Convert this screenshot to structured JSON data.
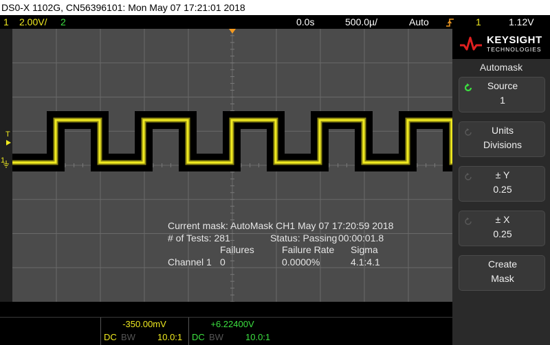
{
  "title": "DS0-X 1102G, CN56396101: Mon May 07 17:21:01 2018",
  "status": {
    "ch1_num": "1",
    "ch1_scale": "2.00V/",
    "ch2_num": "2",
    "time_delay": "0.0s",
    "time_scale": "500.0µ/",
    "trigger_mode": "Auto",
    "trigger_icon": "trigger-edge-icon",
    "trigger_source": "1",
    "trigger_level": "1.12V"
  },
  "markers": {
    "trigger_level": "T",
    "ch1_ground": "1"
  },
  "mask_info": {
    "line1": "Current mask: AutoMask CH1 May 07 17:20:59 2018",
    "tests_label": "# of Tests: 281",
    "status_label": "Status: Passing",
    "elapsed": "00:00:01.8",
    "col_failures": "Failures",
    "col_failure_rate": "Failure Rate",
    "col_sigma": "Sigma",
    "channel": "Channel 1",
    "failures": "0",
    "failure_rate": "0.0000%",
    "sigma": "4.1:4.1"
  },
  "sidebar": {
    "brand": "KEYSIGHT",
    "brand_sub": "TECHNOLOGIES",
    "menu_title": "Automask",
    "softkeys": [
      {
        "label": "Source",
        "value": "1",
        "icon": "rotate-knob-icon",
        "active": true
      },
      {
        "label": "Units",
        "value": "Divisions",
        "icon": "rotate-knob-icon",
        "active": false
      },
      {
        "label": "± Y",
        "value": "0.25",
        "icon": "rotate-knob-icon",
        "active": false
      },
      {
        "label": "± X",
        "value": "0.25",
        "icon": "rotate-knob-icon",
        "active": false
      },
      {
        "label": "Create",
        "value": "Mask",
        "icon": "",
        "active": false
      }
    ]
  },
  "channels": {
    "ch1": {
      "offset": "-350.00mV",
      "coupling": "DC",
      "bw": "BW",
      "probe": "10.0:1"
    },
    "ch2": {
      "offset": "+6.22400V",
      "coupling": "DC",
      "bw": "BW",
      "probe": "10.0:1"
    }
  },
  "colors": {
    "ch1": "#f0ea20",
    "ch2": "#3ce040",
    "grid_bg": "#4b4b4b",
    "mask": "#000000",
    "trigger": "#f39a21"
  }
}
